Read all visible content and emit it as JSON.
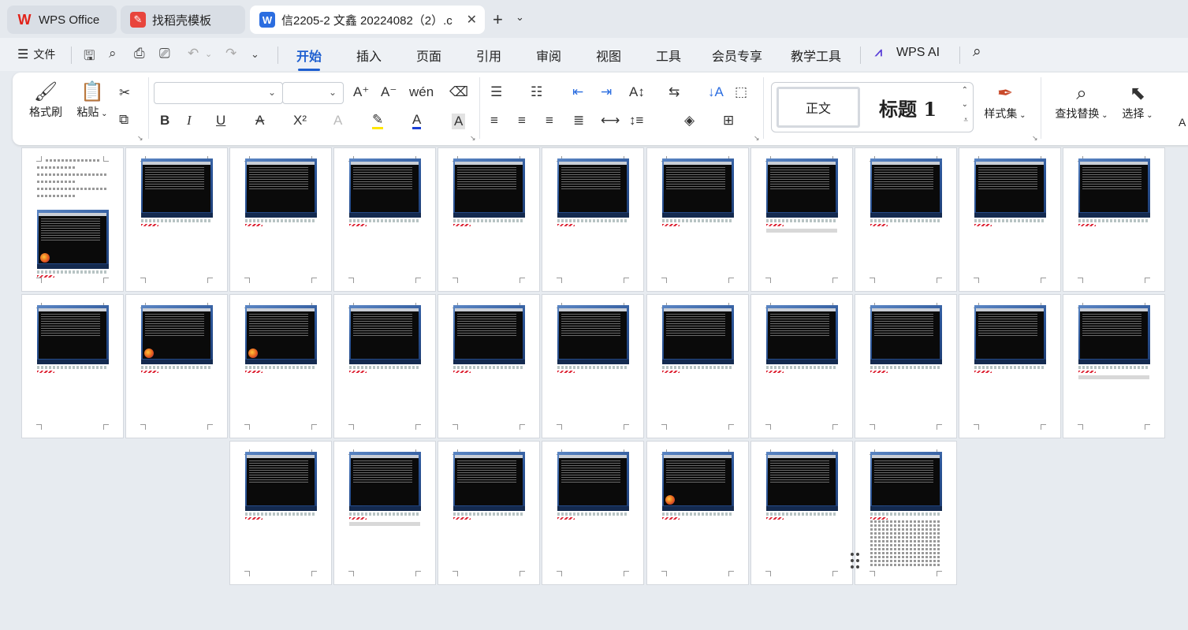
{
  "tabs": [
    {
      "label": "WPS Office",
      "icon": "wps-logo-icon"
    },
    {
      "label": "找稻壳模板",
      "icon": "docer-icon"
    },
    {
      "label": "信2205-2 文鑫 20224082（2）.c",
      "icon": "writer-icon"
    }
  ],
  "menu": {
    "file": "文件",
    "tabs": [
      "开始",
      "插入",
      "页面",
      "引用",
      "审阅",
      "视图",
      "工具",
      "会员专享",
      "教学工具",
      "WPS AI"
    ],
    "active": "开始"
  },
  "ribbon": {
    "format_painter": "格式刷",
    "paste": "粘贴",
    "font_name": "",
    "font_size": "",
    "style_normal": "正文",
    "style_heading": "标题 1",
    "style_set": "样式集",
    "find_replace": "查找替换",
    "select": "选择",
    "cut_off": "A"
  },
  "colors": {
    "accent": "#1e5fd0",
    "highlight": "#ffe600",
    "font_color": "#1a3fd6"
  },
  "pages": {
    "count": 29
  }
}
